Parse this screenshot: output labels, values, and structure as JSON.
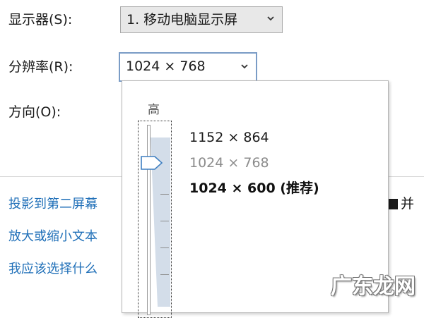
{
  "display": {
    "label": "显示器(S):",
    "selected": "1. 移动电脑显示屏"
  },
  "resolution": {
    "label": "分辨率(R):",
    "selected": "1024 × 768",
    "slider_top_label": "高",
    "options": [
      {
        "label": "1152 × 864",
        "state": "normal"
      },
      {
        "label": "1024 × 768",
        "state": "current"
      },
      {
        "label": "1024 × 600 (推荐)",
        "state": "recommended"
      }
    ]
  },
  "orientation": {
    "label": "方向(O):"
  },
  "links": [
    "投影到第二屏幕",
    "放大或缩小文本",
    "我应该选择什么"
  ],
  "partial_right_text": "并",
  "watermark": "广东龙网",
  "icons": {
    "dropdown": "chevron-down-icon",
    "slider_thumb": "slider-thumb-icon",
    "partial_square": "checkbox-icon"
  }
}
